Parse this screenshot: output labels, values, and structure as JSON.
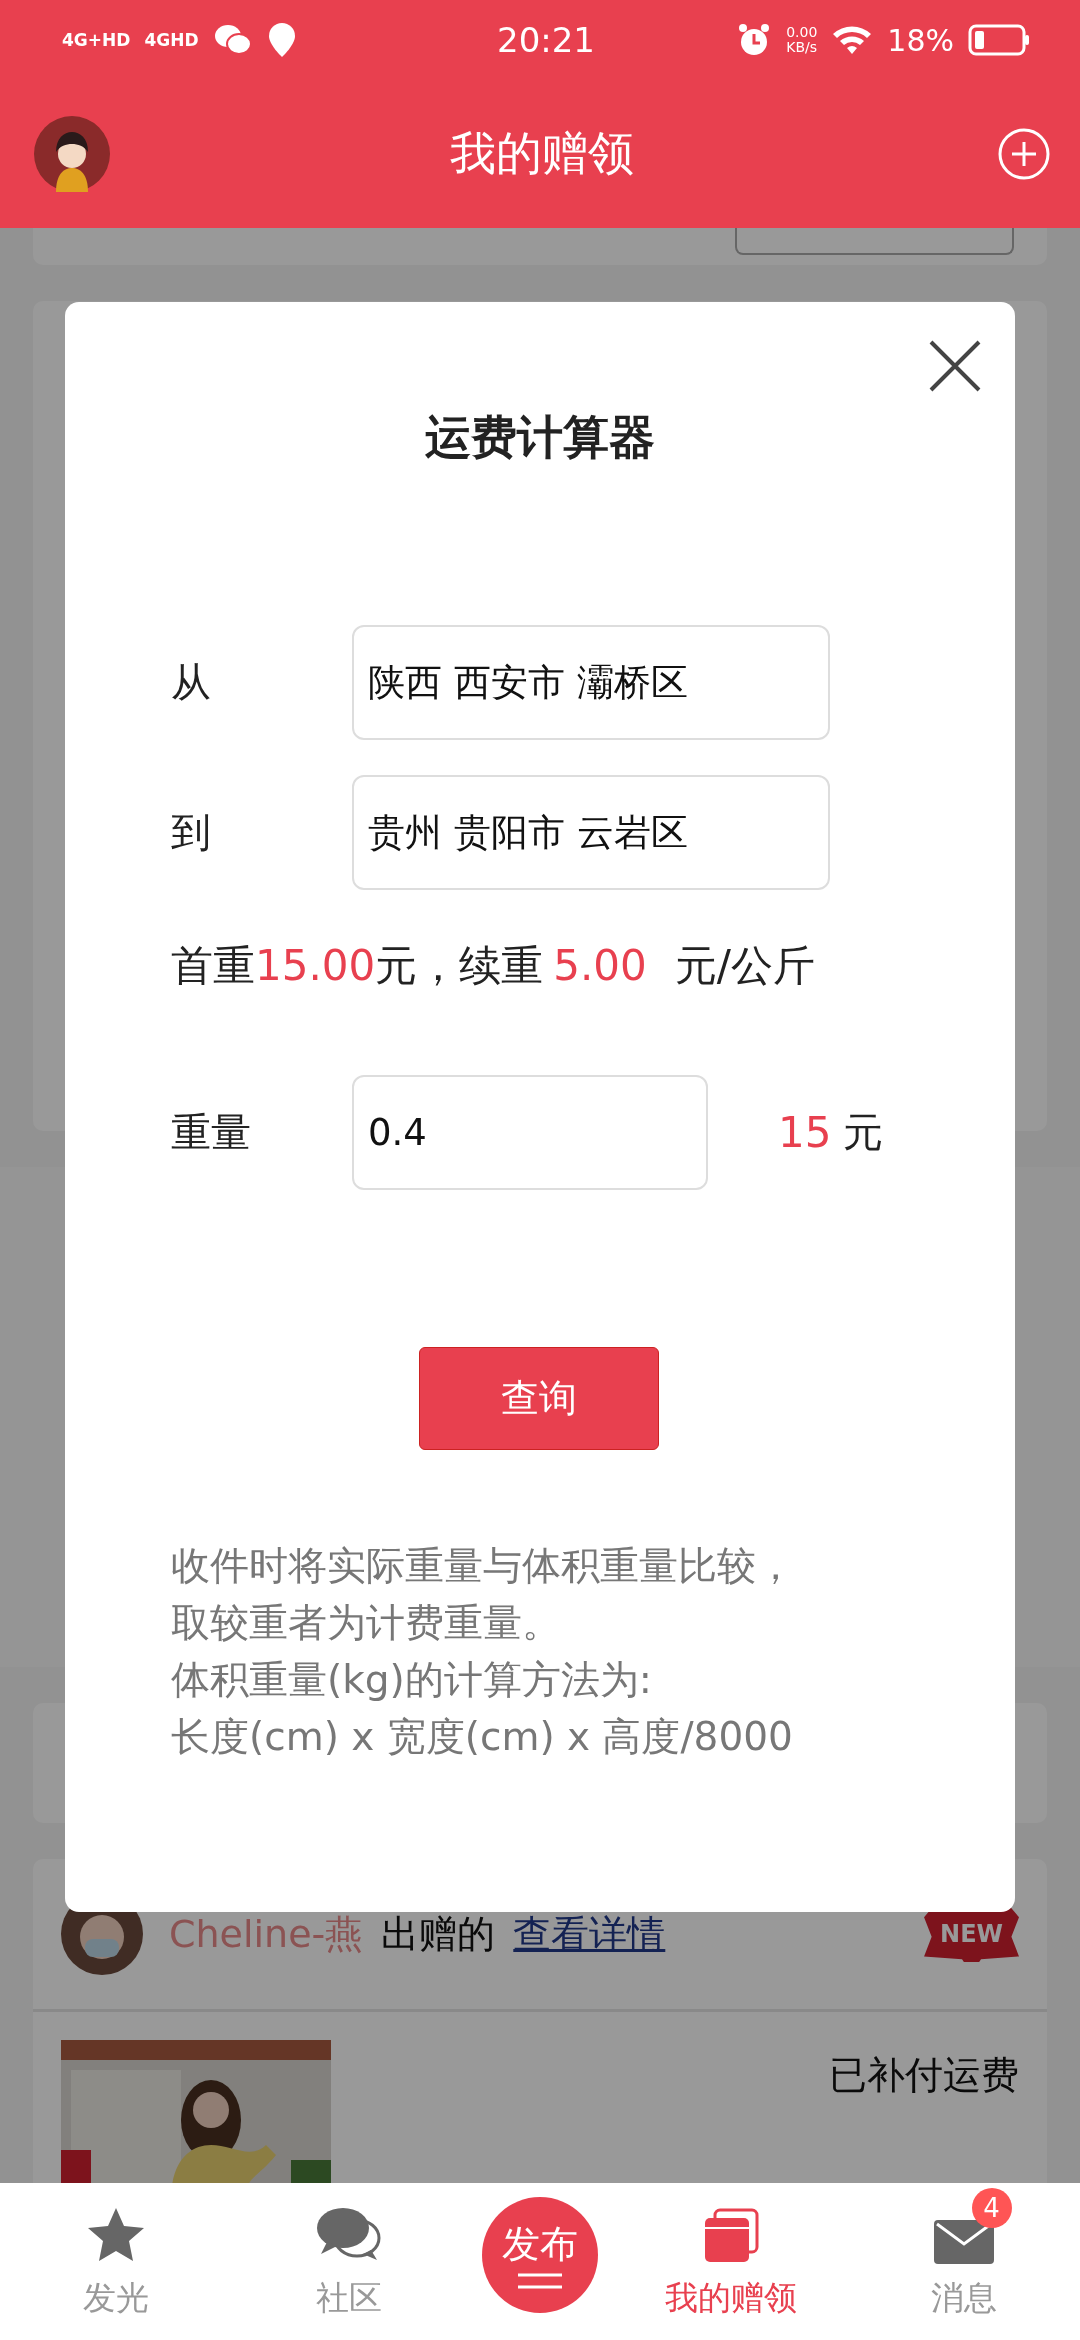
{
  "status_bar": {
    "network_1": "4G+HD",
    "network_2": "4GHD",
    "time": "20:21",
    "speed_value": "0.00",
    "speed_unit": "KB/s",
    "battery": "18%"
  },
  "header": {
    "title": "我的赠领"
  },
  "dialog": {
    "title": "运费计算器",
    "from": {
      "label": "从",
      "value": "陕西 西安市 灞桥区"
    },
    "to": {
      "label": "到",
      "value": "贵州 贵阳市 云岩区"
    },
    "rate": {
      "first_label": "首重",
      "first_price": "15.00",
      "middle": "元，续重",
      "extra_price": "5.00",
      "unit": "元/公斤"
    },
    "weight": {
      "label": "重量",
      "value": "0.4",
      "cost": "15",
      "cost_unit": "元"
    },
    "button": "查询",
    "notes": [
      "收件时将实际重量与体积重量比较，",
      "取较重者为计费重量。",
      "体积重量(kg)的计算方法为:",
      "长度(cm) x 宽度(cm) x 高度/8000"
    ]
  },
  "feed": {
    "giver": "Cheline-燕",
    "action": "出赠的",
    "link": "查看详情",
    "badge": "NEW",
    "status": "已补付运费"
  },
  "tab_bar": [
    {
      "label": "发光",
      "kind": "tab",
      "selected": false
    },
    {
      "label": "社区",
      "kind": "tab",
      "selected": false
    },
    {
      "label": "发布",
      "kind": "publish"
    },
    {
      "label": "我的赠领",
      "kind": "tab",
      "selected": true
    },
    {
      "label": "消息",
      "kind": "tab",
      "selected": false,
      "badge": "4"
    }
  ]
}
